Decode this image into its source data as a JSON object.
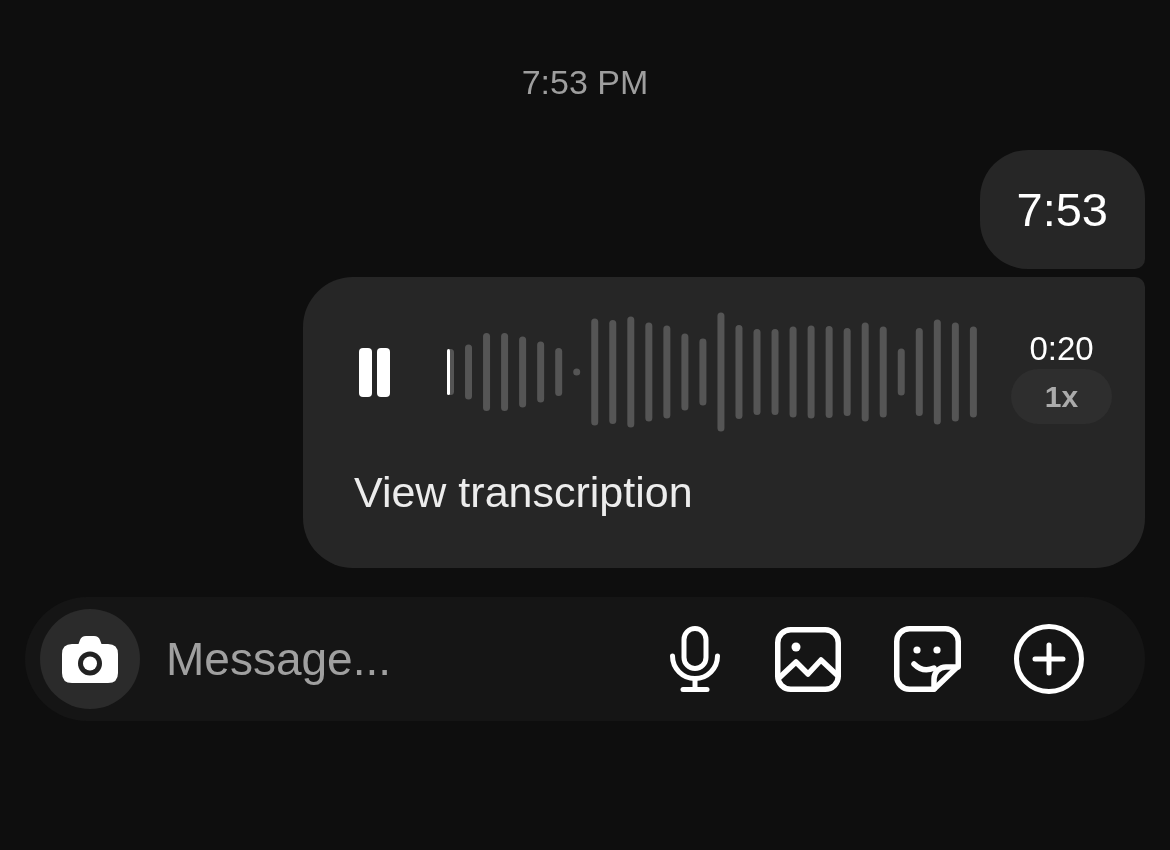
{
  "timestamp": "7:53 PM",
  "messages": [
    {
      "kind": "text",
      "text": "7:53"
    },
    {
      "kind": "voice",
      "playing": true,
      "level": 0,
      "duration": "0:20",
      "speed": "1x",
      "transcription": "View transcription"
    }
  ],
  "composer": {
    "placeholder": "Message..."
  }
}
